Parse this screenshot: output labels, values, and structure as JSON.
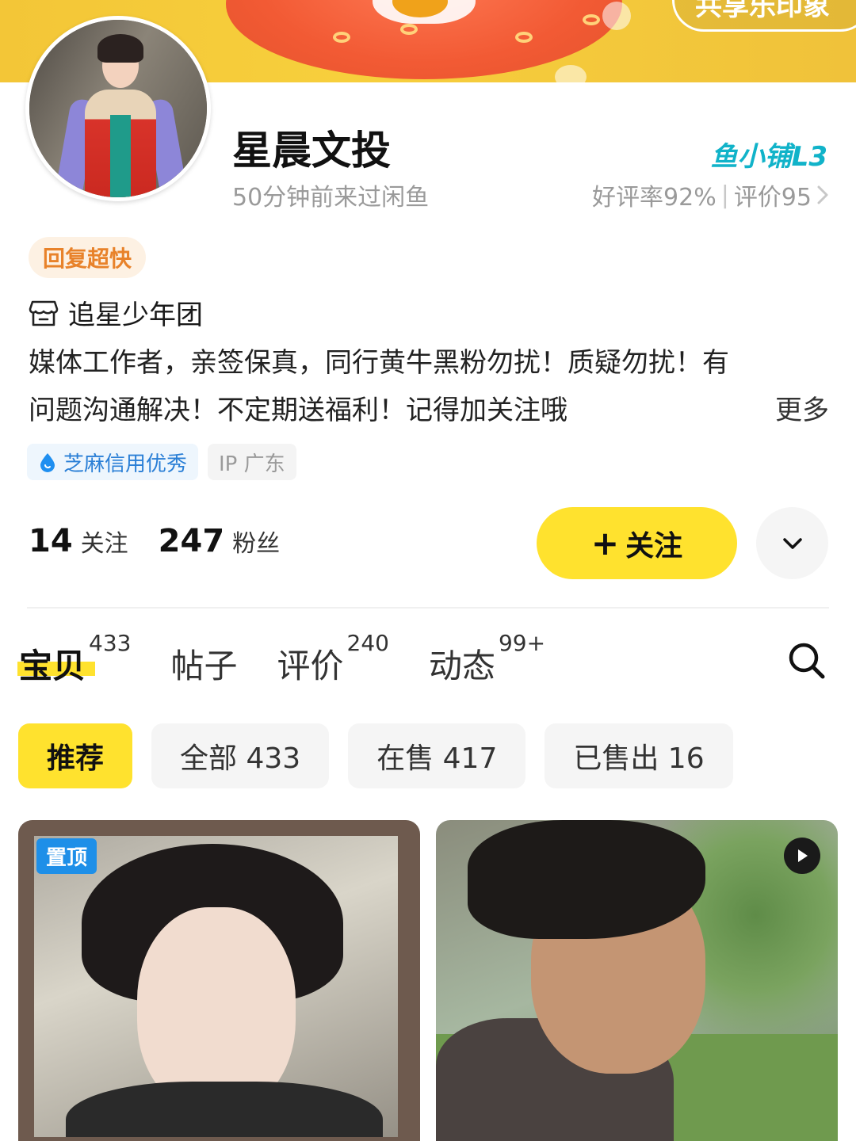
{
  "banner": {
    "link_text": "共享乐印象"
  },
  "profile": {
    "shop_name": "星晨文投",
    "last_seen": "50分钟前来过闲鱼",
    "level_badge": "鱼小铺L3",
    "rating_text": "好评率92%",
    "review_text": "评价95",
    "tag_fast_reply": "回复超快",
    "shop_title": "追星少年团",
    "bio_line1": "媒体工作者，亲签保真，同行黄牛黑粉勿扰！质疑勿扰！有",
    "bio_line2": "问题沟通解决！不定期送福利！记得加关注哦",
    "more": "更多",
    "credit_chip": "芝麻信用优秀",
    "ip_chip": "IP 广东"
  },
  "stats": {
    "following_count": "14",
    "following_label": "关注",
    "fans_count": "247",
    "fans_label": "粉丝"
  },
  "actions": {
    "follow_plus": "+",
    "follow_label": "关注"
  },
  "tabs": [
    {
      "label": "宝贝",
      "count": "433"
    },
    {
      "label": "帖子",
      "count": ""
    },
    {
      "label": "评价",
      "count": "240"
    },
    {
      "label": "动态",
      "count": "99+"
    }
  ],
  "filters": [
    {
      "label": "推荐"
    },
    {
      "label": "全部 433"
    },
    {
      "label": "在售 417"
    },
    {
      "label": "已售出 16"
    }
  ],
  "cards": [
    {
      "badge": "置顶"
    }
  ],
  "colors": {
    "accent_yellow": "#ffe22e",
    "level_teal": "#11b3c9",
    "credit_blue": "#2a7fd6",
    "fast_orange": "#e8822a"
  },
  "icons": {
    "store": "store-icon",
    "drop": "drop-icon",
    "chevron_down": "chevron-down-icon",
    "chevron_right": "chevron-right-icon",
    "search": "search-icon",
    "play": "play-icon"
  }
}
